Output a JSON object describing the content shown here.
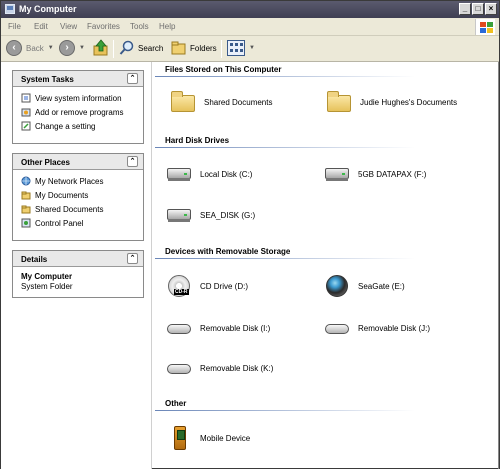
{
  "window": {
    "title": "My Computer"
  },
  "menu": [
    "File",
    "Edit",
    "View",
    "Favorites",
    "Tools",
    "Help"
  ],
  "toolbar": {
    "back": "Back",
    "search": "Search",
    "folders": "Folders"
  },
  "panels": [
    {
      "title": "System Tasks",
      "items": [
        "View system information",
        "Add or remove programs",
        "Change a setting"
      ]
    },
    {
      "title": "Other Places",
      "items": [
        "My Network Places",
        "My Documents",
        "Shared Documents",
        "Control Panel"
      ]
    },
    {
      "title": "Details",
      "items": [
        "My Computer",
        "System Folder"
      ]
    }
  ],
  "sections": [
    {
      "title": "Files Stored on This Computer",
      "items": [
        "Shared Documents",
        "Judie Hughes's Documents"
      ]
    },
    {
      "title": "Hard Disk Drives",
      "items": [
        "Local Disk (C:)",
        "5GB DATAPAX (F:)",
        "SEA_DISK (G:)"
      ]
    },
    {
      "title": "Devices with Removable Storage",
      "items": [
        "CD Drive (D:)",
        "SeaGate (E:)",
        "Removable Disk (I:)",
        "Removable Disk (J:)",
        "Removable Disk (K:)"
      ]
    },
    {
      "title": "Other",
      "items": [
        "Mobile Device"
      ]
    }
  ],
  "icons": {
    "cd_badge": "CD-R"
  }
}
